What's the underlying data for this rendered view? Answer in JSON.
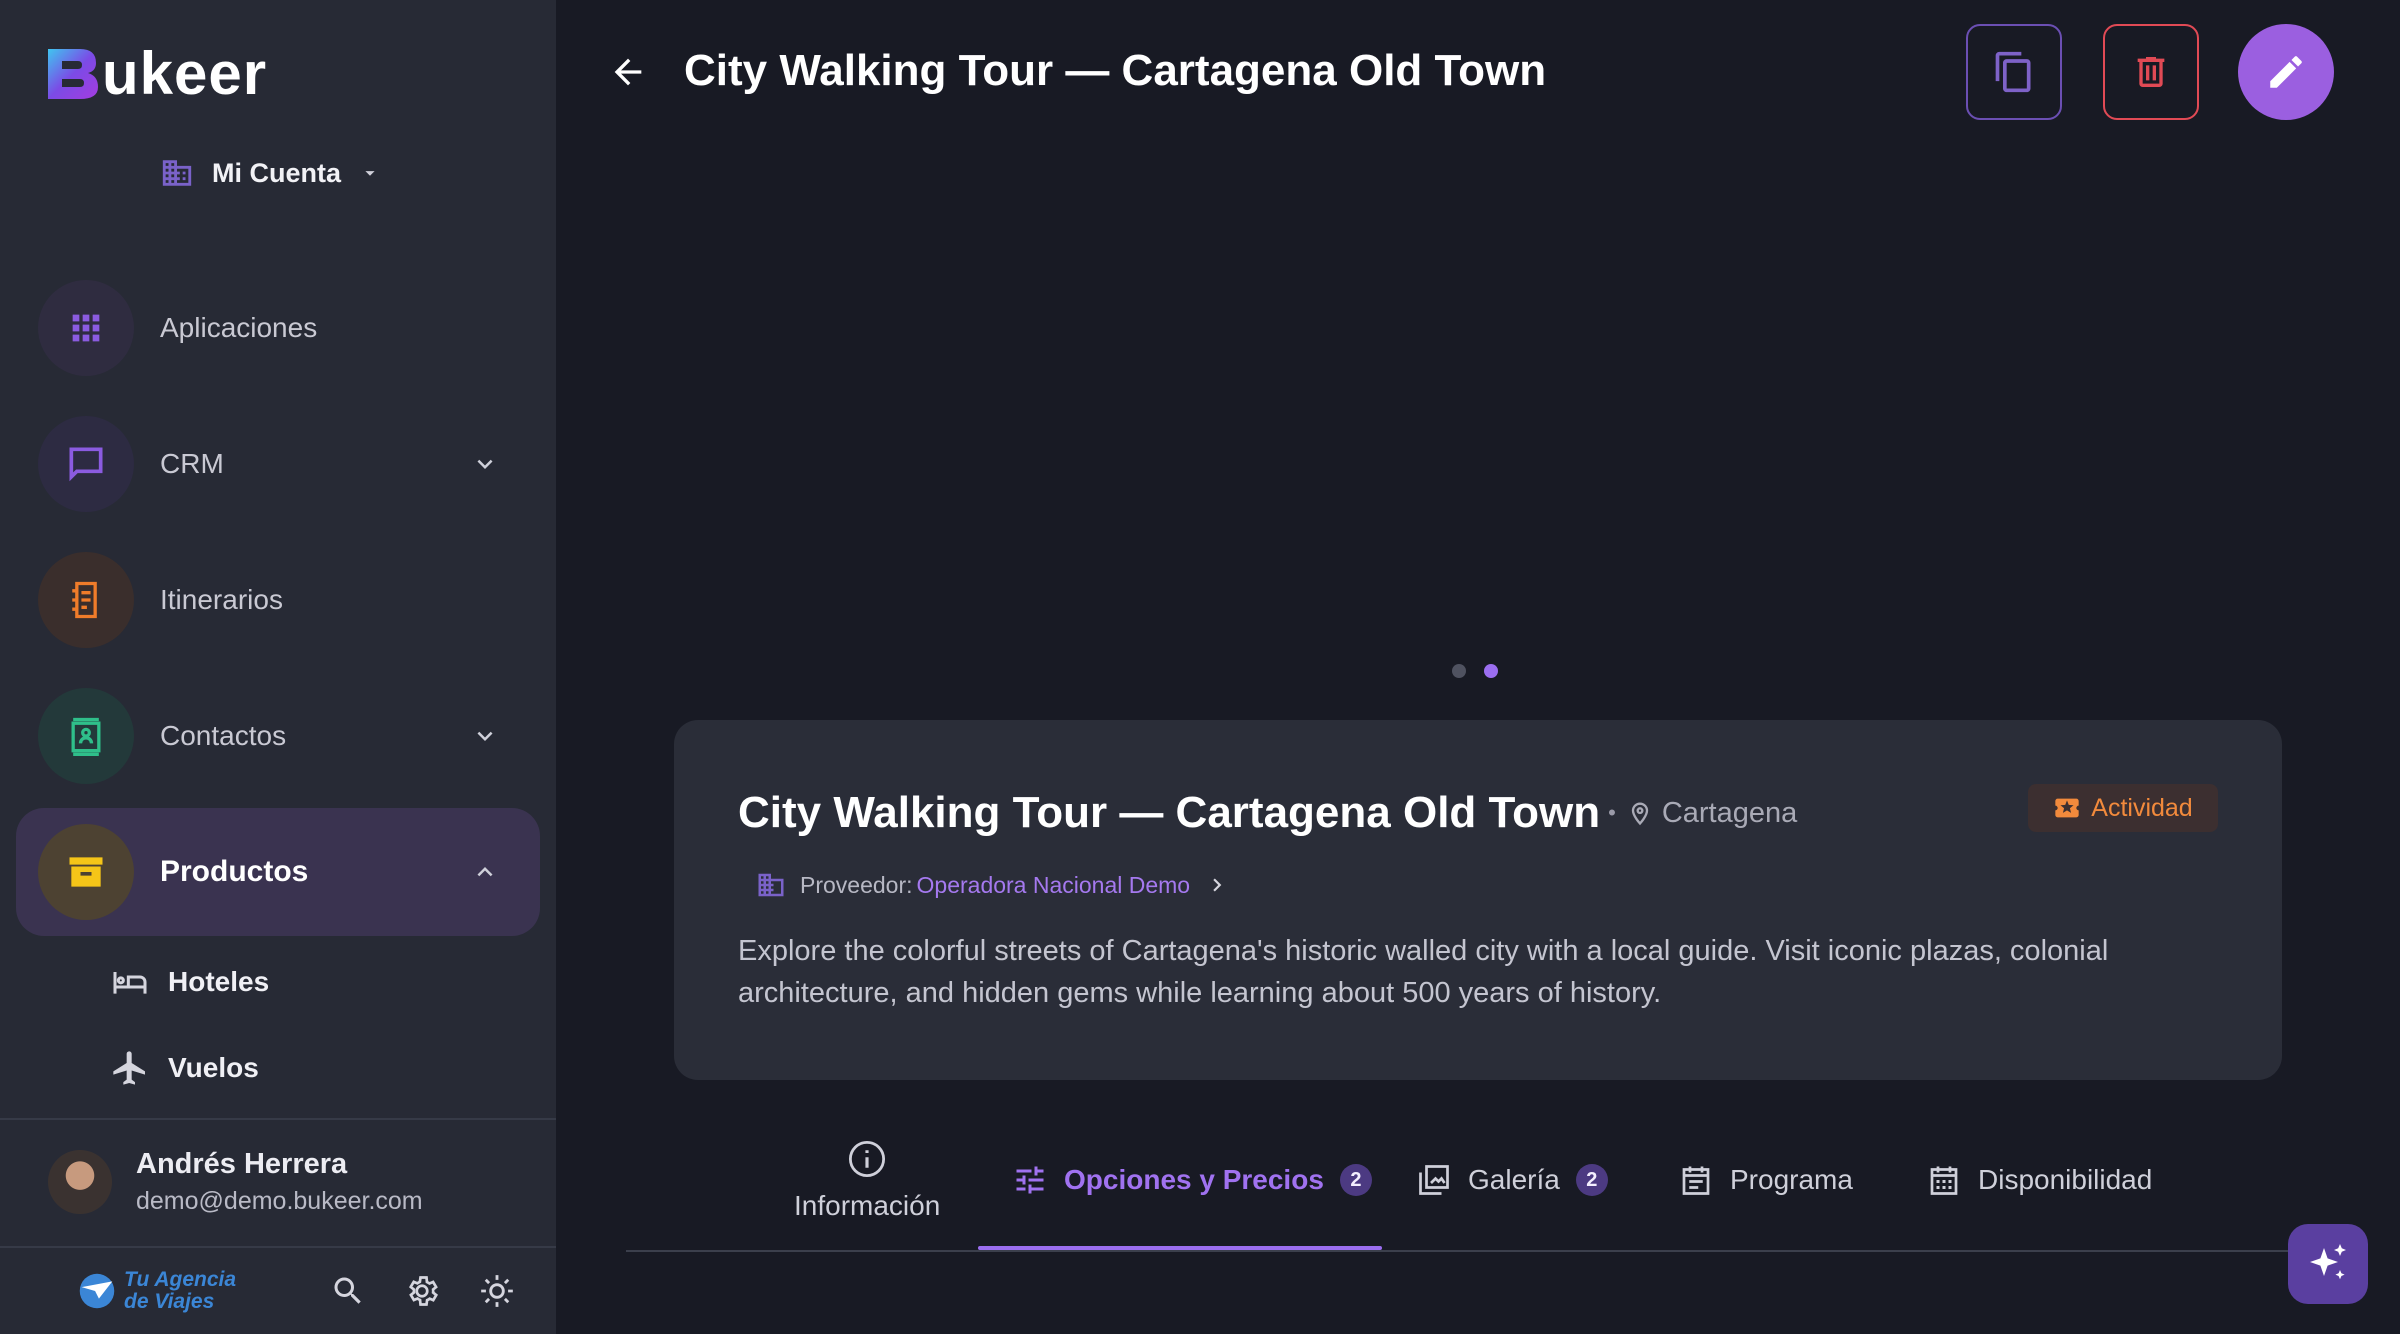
{
  "brand": {
    "name": "ukeer",
    "logo_icon": "b-mark-icon"
  },
  "account": {
    "label": "Mi Cuenta"
  },
  "nav": {
    "apps": "Aplicaciones",
    "crm": "CRM",
    "itineraries": "Itinerarios",
    "contacts": "Contactos",
    "products": "Productos",
    "hotels": "Hoteles",
    "flights": "Vuelos"
  },
  "user": {
    "name": "Andrés Herrera",
    "email": "demo@demo.bukeer.com"
  },
  "agency": {
    "line1": "Tu Agencia",
    "line2": "de Viajes"
  },
  "header": {
    "title": "City Walking Tour — Cartagena Old Town"
  },
  "product": {
    "title": "City Walking Tour — Cartagena Old Town",
    "location": "Cartagena",
    "type_badge": "Actividad",
    "provider_prefix": "Proveedor:",
    "provider_name": "Operadora Nacional Demo",
    "description": "Explore the colorful streets of Cartagena's historic walled city with a local guide. Visit iconic plazas, colonial architecture, and hidden gems while learning about 500 years of history."
  },
  "carousel": {
    "slide_count": 2,
    "active_slide": 2
  },
  "tabs": {
    "info": "Información",
    "options": "Opciones y Precios",
    "options_count": "2",
    "gallery": "Galería",
    "gallery_count": "2",
    "program": "Programa",
    "availability": "Disponibilidad"
  },
  "colors": {
    "accent": "#9b6ef0",
    "danger": "#e14a55",
    "activity": "#f28a3c",
    "products": "#f5c518",
    "itineraries": "#f07c2a",
    "contacts": "#2fbf8a"
  }
}
